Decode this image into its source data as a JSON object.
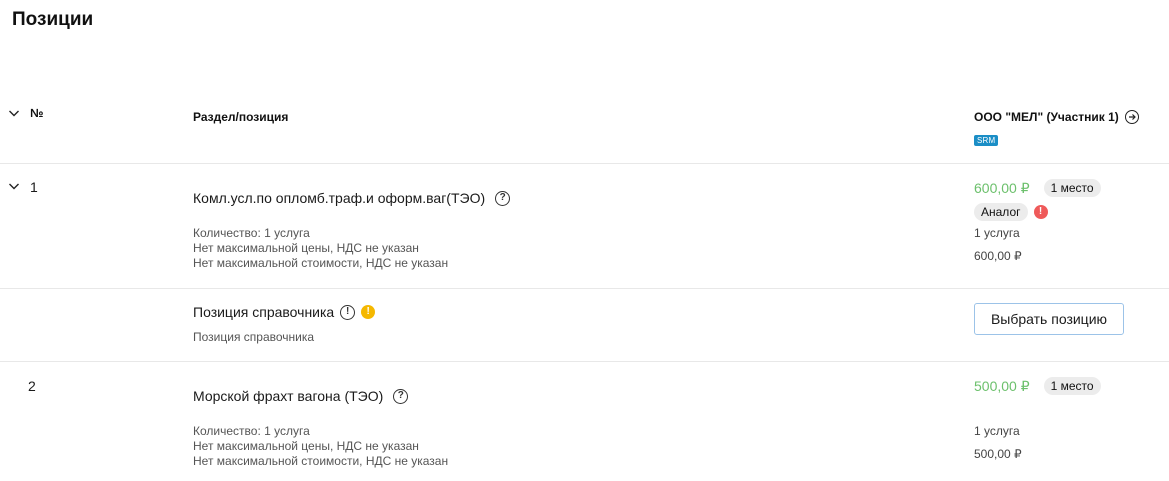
{
  "page": {
    "title": "Позиции"
  },
  "header": {
    "number_label": "№",
    "section_label": "Раздел/позиция",
    "participant": "ООО \"МЕЛ\" (Участник 1)",
    "srm_badge": "SRM"
  },
  "rows": [
    {
      "number": "1",
      "title": "Комл.усл.по опломб.траф.и оформ.ваг(ТЭО)",
      "quantity": "Количество: 1 услуга",
      "no_max_price": "Нет максимальной цены, НДС не указан",
      "no_max_cost": "Нет максимальной стоимости, НДС не указан",
      "price": "600,00 ₽",
      "place": "1 место",
      "analog": "Аналог",
      "unit": "1 услуга",
      "total": "600,00 ₽"
    },
    {
      "number": "2",
      "title": "Морской фрахт вагона (ТЭО)",
      "quantity": "Количество: 1 услуга",
      "no_max_price": "Нет максимальной цены, НДС не указан",
      "no_max_cost": "Нет максимальной стоимости, НДС не указан",
      "price": "500,00 ₽",
      "place": "1 место",
      "unit": "1 услуга",
      "total": "500,00 ₽"
    }
  ],
  "reference": {
    "title": "Позиция справочника",
    "subtitle": "Позиция справочника",
    "select_button": "Выбрать позицию"
  },
  "icons": {
    "question": "question-circle-icon",
    "info": "info-circle-icon",
    "warning": "warning-icon",
    "error": "error-icon",
    "arrow": "arrow-right-circle-icon",
    "chevron": "chevron-down-icon"
  },
  "colors": {
    "price_green": "#6cc06c",
    "warning": "#f5b800",
    "error": "#ef5a5a",
    "srm": "#1b8ec6"
  }
}
